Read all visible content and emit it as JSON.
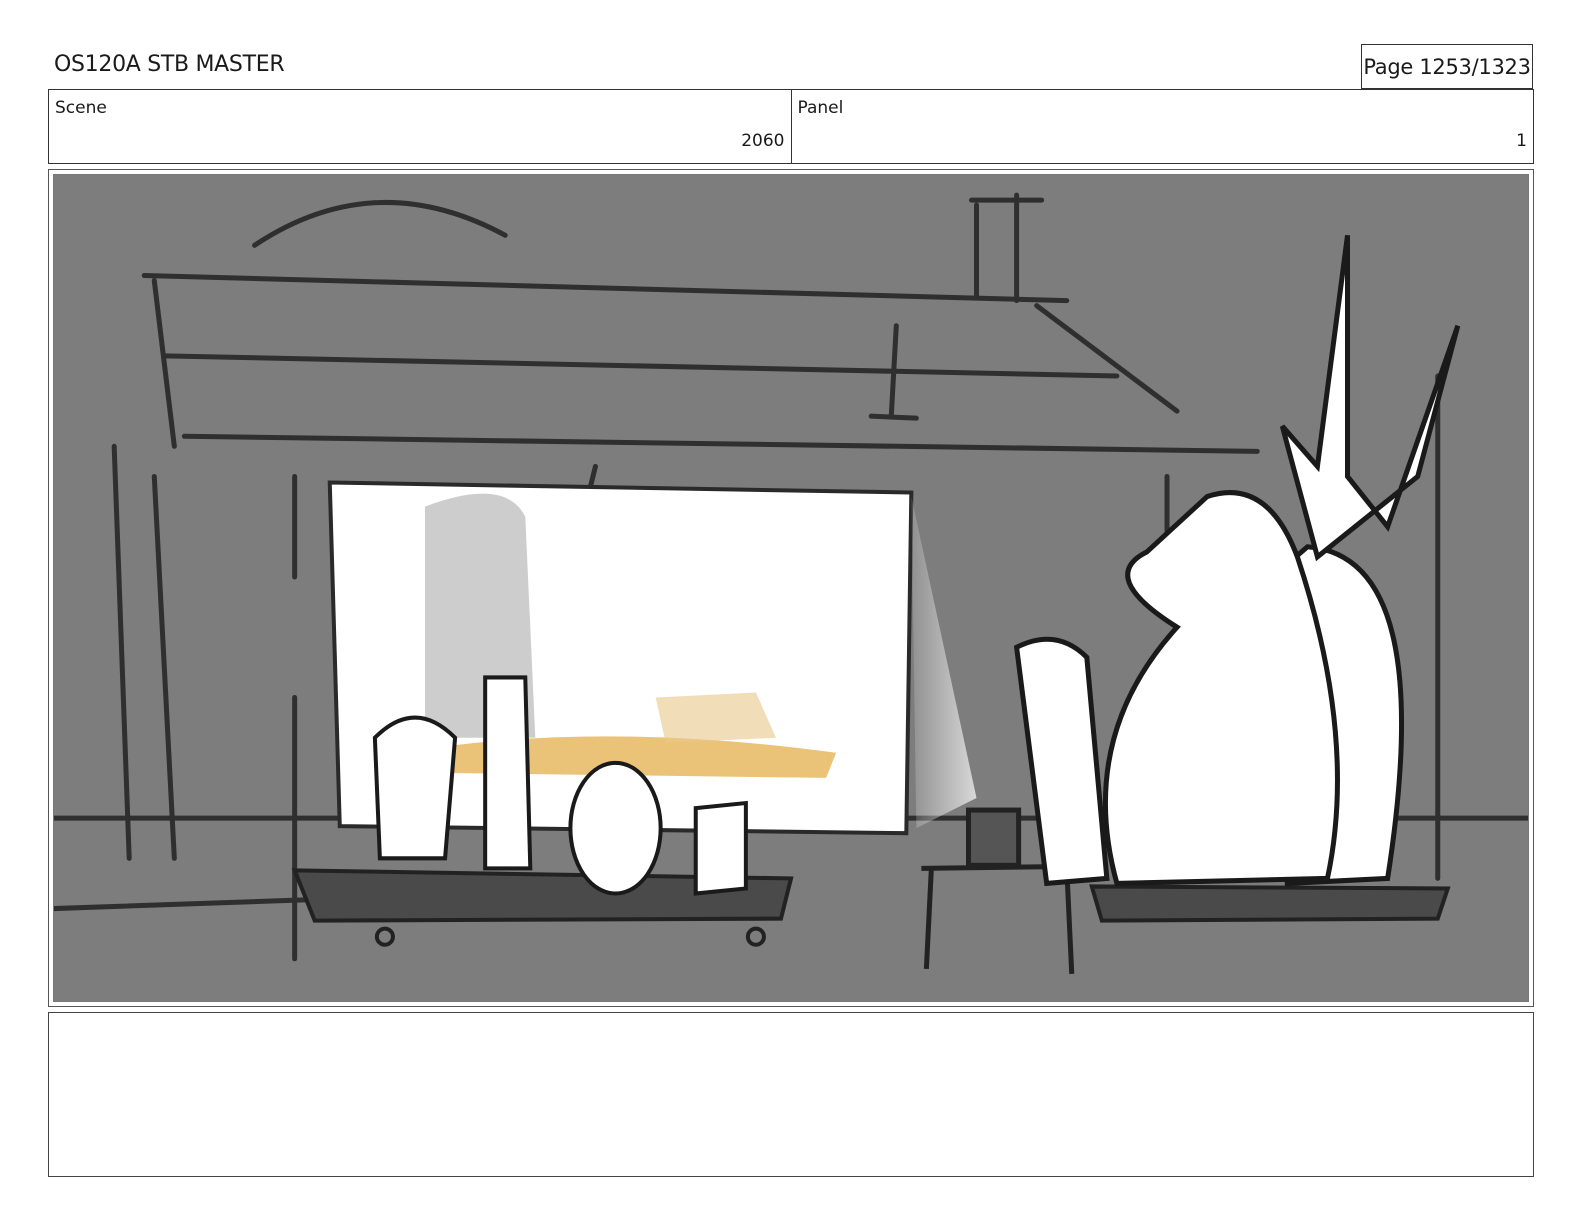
{
  "header": {
    "document_title": "OS120A STB MASTER",
    "page_indicator": "Page 1253/1323"
  },
  "info": {
    "scene_label": "Scene",
    "scene_value": "2060",
    "panel_label": "Panel",
    "panel_value": "1"
  },
  "colors": {
    "background_gray": "#7d7d7d",
    "line_dark": "#2a2a2a",
    "highlight_white": "#ffffff",
    "accent_orange": "#e8b860"
  }
}
